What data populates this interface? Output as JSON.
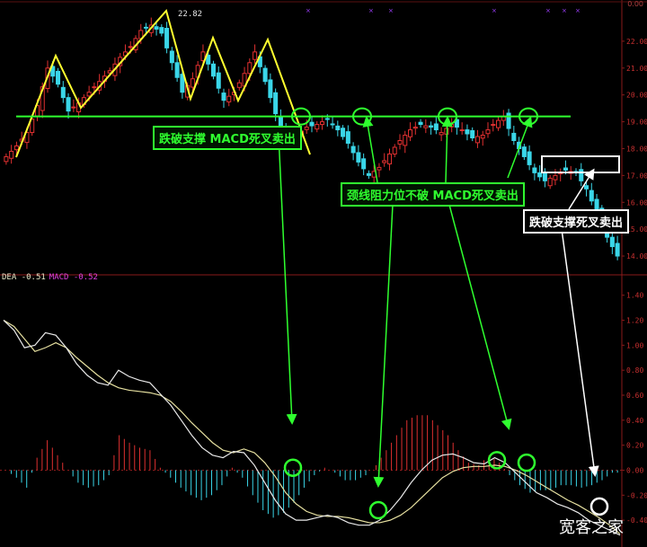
{
  "chart_data": [
    {
      "type": "candlestick",
      "panel": "price",
      "ylim": [
        13.5,
        23.2
      ],
      "y_ticks": [
        "22.00",
        "21.00",
        "20.00",
        "19.00",
        "18.00",
        "17.00",
        "16.00",
        "15.00",
        "14.00"
      ],
      "peak_label": "22.82",
      "neckline_value": 19.2,
      "annotations": {
        "break_support": "跌破支撑 MACD死叉卖出",
        "neckline_fail": "颈线阻力位不破 MACD死叉卖出",
        "break_support2": "跌破支撑死叉卖出"
      },
      "close_path": [
        17.7,
        18.1,
        18.6,
        19.6,
        21.0,
        20.4,
        19.4,
        19.7,
        20.1,
        20.5,
        20.9,
        21.4,
        21.8,
        22.4,
        22.6,
        22.3,
        21.2,
        20.1,
        20.6,
        21.6,
        20.7,
        19.8,
        20.1,
        20.8,
        21.6,
        20.5,
        19.3,
        18.2,
        18.5,
        18.8,
        18.9,
        19.1,
        18.7,
        18.2,
        17.5,
        17.0,
        17.3,
        17.8,
        18.3,
        18.7,
        18.9,
        18.8,
        18.6,
        18.9,
        18.7,
        18.4,
        18.5,
        18.9,
        19.2,
        18.3,
        17.7,
        17.1,
        16.8,
        17.0,
        17.2,
        17.1,
        16.5,
        15.6,
        14.7,
        14.0
      ]
    },
    {
      "type": "macd",
      "panel": "indicator",
      "ylim": [
        -0.55,
        1.52
      ],
      "y_ticks": [
        "1.40",
        "1.20",
        "1.00",
        "0.80",
        "0.60",
        "0.40",
        "0.20",
        "0.00",
        "-0.20",
        "-0.40"
      ],
      "series": [
        {
          "name": "DEA",
          "value": -0.51,
          "color": "#e6e0a0",
          "values": [
            1.2,
            1.15,
            1.05,
            0.95,
            0.98,
            1.02,
            0.98,
            0.9,
            0.83,
            0.76,
            0.7,
            0.66,
            0.64,
            0.63,
            0.62,
            0.6,
            0.55,
            0.47,
            0.38,
            0.3,
            0.22,
            0.16,
            0.14,
            0.17,
            0.14,
            0.06,
            -0.05,
            -0.18,
            -0.27,
            -0.33,
            -0.36,
            -0.37,
            -0.37,
            -0.38,
            -0.4,
            -0.42,
            -0.42,
            -0.4,
            -0.36,
            -0.3,
            -0.22,
            -0.14,
            -0.06,
            -0.01,
            0.02,
            0.03,
            0.03,
            0.04,
            0.03,
            0.0,
            -0.04,
            -0.09,
            -0.14,
            -0.19,
            -0.24,
            -0.28,
            -0.33,
            -0.38,
            -0.44,
            -0.51
          ]
        },
        {
          "name": "MACD",
          "value": -0.52,
          "color": "#e8e8e8",
          "values": [
            1.2,
            1.12,
            0.98,
            1.0,
            1.1,
            1.08,
            0.98,
            0.85,
            0.76,
            0.7,
            0.68,
            0.8,
            0.75,
            0.72,
            0.7,
            0.61,
            0.52,
            0.4,
            0.28,
            0.18,
            0.12,
            0.1,
            0.15,
            0.14,
            0.04,
            -0.1,
            -0.24,
            -0.35,
            -0.4,
            -0.4,
            -0.38,
            -0.36,
            -0.38,
            -0.42,
            -0.44,
            -0.44,
            -0.4,
            -0.32,
            -0.22,
            -0.1,
            0.0,
            0.08,
            0.12,
            0.13,
            0.1,
            0.06,
            0.05,
            0.1,
            0.06,
            -0.02,
            -0.1,
            -0.18,
            -0.22,
            -0.27,
            -0.3,
            -0.34,
            -0.4,
            -0.44,
            -0.48,
            -0.52
          ]
        }
      ]
    }
  ],
  "brand": "宽客之家",
  "corner_text": "0.00"
}
